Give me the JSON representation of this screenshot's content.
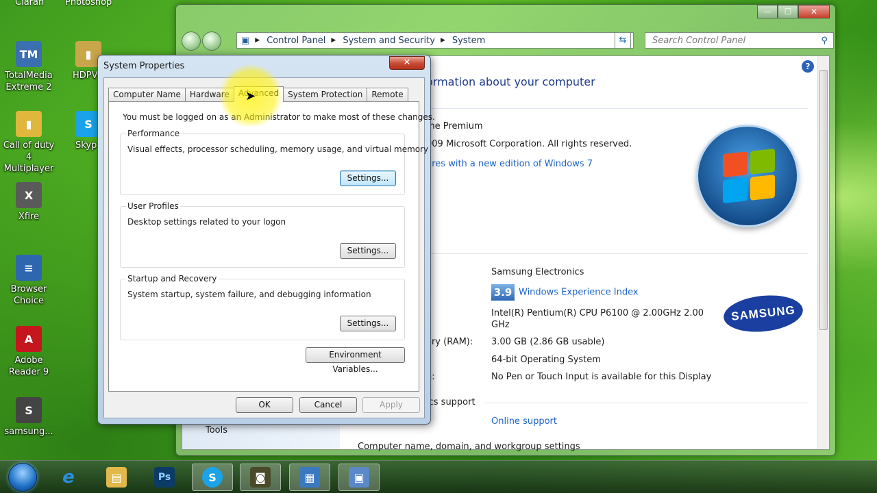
{
  "desktop": {
    "top_labels": [
      "Ciaran",
      "Photoshop"
    ],
    "icons": [
      {
        "label": "TotalMedia Extreme 2",
        "glyph": "TM",
        "color": "#3a6fb0"
      },
      {
        "label": "HDPV",
        "glyph": "▮",
        "color": "#caa64a"
      },
      {
        "label": "Call of duty 4 Multiplayer",
        "glyph": "▮",
        "color": "#e0b63c"
      },
      {
        "label": "Skyp",
        "glyph": "S",
        "color": "#1aa3e8"
      },
      {
        "label": "Xfire",
        "glyph": "X",
        "color": "#5a5a5a"
      },
      {
        "label": "Browser Choice",
        "glyph": "≡",
        "color": "#2f66b0"
      },
      {
        "label": "Adobe Reader 9",
        "glyph": "A",
        "color": "#c4161c"
      },
      {
        "label": "samsung...",
        "glyph": "S",
        "color": "#444"
      }
    ]
  },
  "control_panel": {
    "breadcrumbs": [
      "Control Panel",
      "System and Security",
      "System"
    ],
    "search_placeholder": "Search Control Panel",
    "heading": "ormation about your computer",
    "edition_text": "me Premium",
    "copyright": "009 Microsoft Corporation.  All rights reserved.",
    "upgrade_link": "ures with a new edition of Windows 7",
    "manufacturer": "Samsung Electronics",
    "rating_value": "3.9",
    "rating_link": "Windows Experience Index",
    "processor_line1": "Intel(R) Pentium(R) CPU       P6100  @ 2.00GHz   2.00",
    "processor_line2": "GHz",
    "memory_label": "ory (RAM):",
    "memory_value": "3.00 GB (2.86 GB usable)",
    "system_type": "64-bit Operating System",
    "pen_label": "h:",
    "pen_value": "No Pen or Touch Input is available for this Display",
    "support_label": "ics support",
    "online_support": "Online support",
    "domain_settings": "Computer name, domain, and workgroup settings",
    "tools_label": "Tools",
    "help": "?",
    "brand_logo": "SAMSUNG"
  },
  "dialog": {
    "title": "System Properties",
    "close": "✕",
    "tabs": [
      "Computer Name",
      "Hardware",
      "Advanced",
      "System Protection",
      "Remote"
    ],
    "active_tab": "Advanced",
    "admin_note": "You must be logged on as an Administrator to make most of these changes.",
    "performance": {
      "title": "Performance",
      "desc": "Visual effects, processor scheduling, memory usage, and virtual memory",
      "button": "Settings..."
    },
    "user_profiles": {
      "title": "User Profiles",
      "desc": "Desktop settings related to your logon",
      "button": "Settings..."
    },
    "startup": {
      "title": "Startup and Recovery",
      "desc": "System startup, system failure, and debugging information",
      "button": "Settings..."
    },
    "env_button": "Environment Variables...",
    "ok": "OK",
    "cancel": "Cancel",
    "apply": "Apply"
  },
  "taskbar": {
    "items": [
      {
        "name": "internet-explorer",
        "glyph": "e",
        "color": "#2a8fe0"
      },
      {
        "name": "windows-explorer",
        "glyph": "▤",
        "color": "#e2b84a"
      },
      {
        "name": "photoshop",
        "glyph": "Ps",
        "color": "#0b3b66"
      },
      {
        "name": "skype",
        "glyph": "S",
        "color": "#1aa3e8"
      },
      {
        "name": "camera-app",
        "glyph": "◙",
        "color": "#4a4a2a"
      },
      {
        "name": "control-panel",
        "glyph": "▦",
        "color": "#3a78c0"
      },
      {
        "name": "system-properties",
        "glyph": "▣",
        "color": "#5a88c8"
      }
    ]
  }
}
